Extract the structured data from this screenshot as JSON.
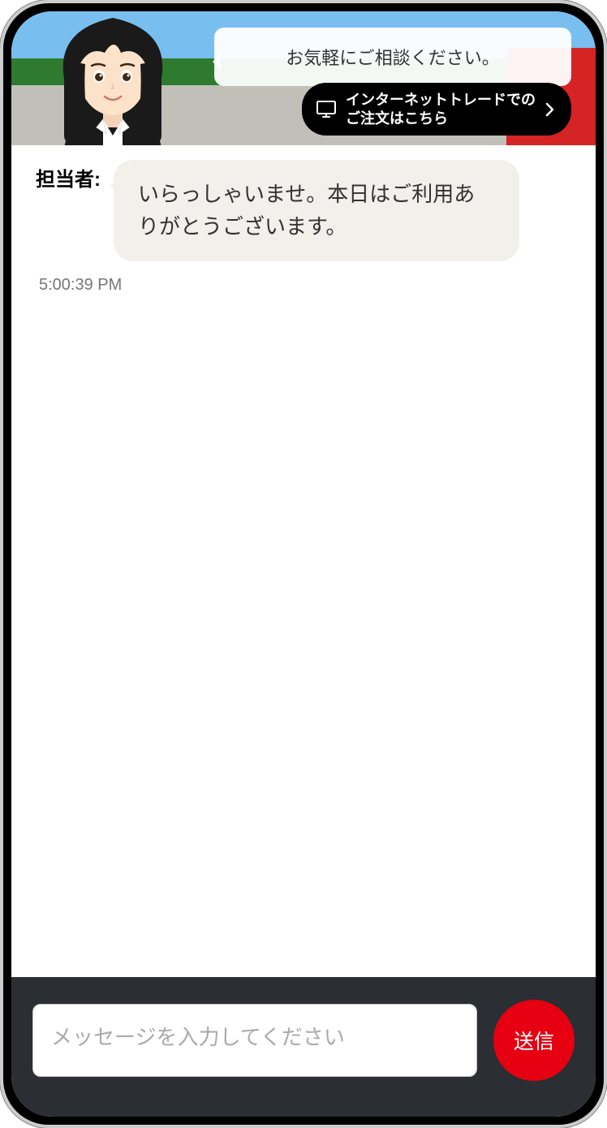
{
  "header": {
    "speech_bubble": "お気軽にご相談ください。",
    "trade_button_line1": "インターネットトレードでの",
    "trade_button_line2": "ご注文はこちら"
  },
  "chat": {
    "sender_label": "担当者:",
    "messages": [
      {
        "text": "いらっしゃいませ。本日はご利用ありがとうございます。",
        "time": "5:00:39 PM"
      }
    ]
  },
  "input": {
    "placeholder": "メッセージを入力してください",
    "send_label": "送信"
  }
}
